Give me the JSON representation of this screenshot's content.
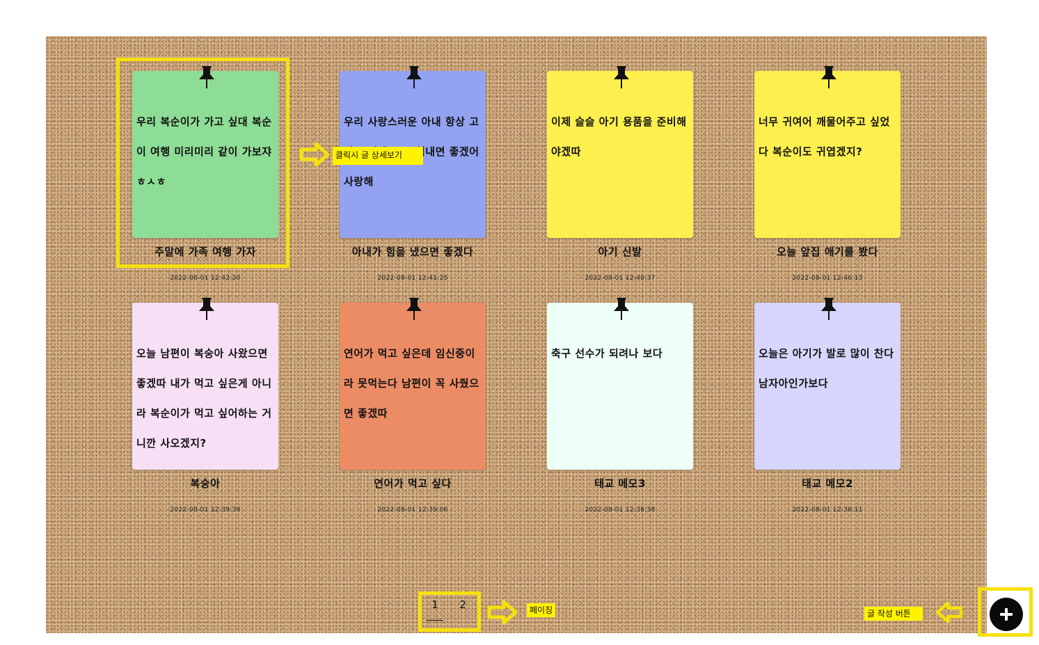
{
  "memos": [
    {
      "body": "우리 복순이가 가고 싶대 복순이 여행 미리미리 같이 가보쟈ㅎㅅㅎ",
      "title": "주말에 가족 여행 가자",
      "date": "2022-08-01 12:42:20",
      "color": "#8edd96"
    },
    {
      "body": "우리 사랑스러운 아내 항상 고맙고 이제 조금 힘내면 좋겠어 사랑해",
      "title": "아내가 힘을 냈으면 좋겠다",
      "date": "2022-08-01 12:41:25",
      "color": "#93a3f2"
    },
    {
      "body": "이제 슬슬 아기 용품을 준비해야겠따",
      "title": "아기 신발",
      "date": "2022-08-01 12:40:37",
      "color": "#fdf04e"
    },
    {
      "body": "너무 귀여어 깨물어주고 싶었다 복순이도 귀엽겠지?",
      "title": "오늘 앞집 애기를 봤다",
      "date": "2022-08-01 12:40:13",
      "color": "#fdf04e"
    },
    {
      "body": "오늘 남편이 복숭아 사왔으면 좋겠따 내가 먹고 싶은게 아니라 복순이가 먹고 싶어하는 거니깐 사오겠지?",
      "title": "복숭아",
      "date": "2022-08-01 12:39:39",
      "color": "#f7dff5"
    },
    {
      "body": "연어가 먹고 싶은데 임신중이라 못먹는다 남편이 꼭 사줬으면 좋겠따",
      "title": "연어가 먹고 싶다",
      "date": "2022-08-01 12:39:06",
      "color": "#ec8c65"
    },
    {
      "body": "축구 선수가 되려나 보다",
      "title": "태교 메모3",
      "date": "2022-08-01 12:38:38",
      "color": "#edfff6"
    },
    {
      "body": "오늘은 아기가 발로 많이 찬다 남자아인가보다",
      "title": "태교 메모2",
      "date": "2022-08-01 12:38:11",
      "color": "#d6d6fe"
    }
  ],
  "pagination": {
    "pages": [
      "1",
      "2"
    ],
    "current": "1"
  },
  "annotations": {
    "detail_hint": "클릭시 글 상세보기",
    "paging_hint": "페이징",
    "write_hint": "글 작성 버튼"
  },
  "icons": {
    "pin": "pushpin-icon",
    "write": "plus-icon"
  },
  "colors": {
    "board": "#c9a378",
    "highlight": "#f5e10a",
    "tag": "#fff200",
    "write_button": "#0a0a0a"
  }
}
